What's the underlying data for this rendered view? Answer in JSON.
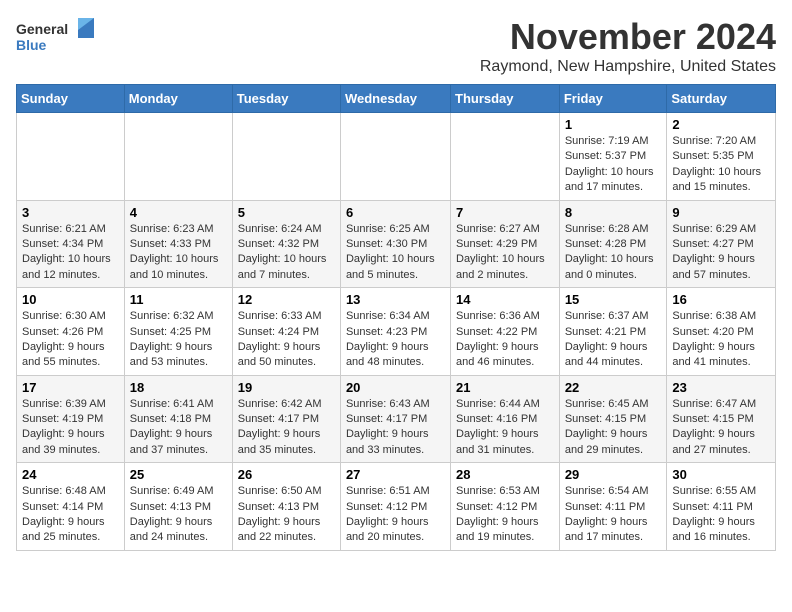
{
  "logo": {
    "general": "General",
    "blue": "Blue"
  },
  "title": "November 2024",
  "location": "Raymond, New Hampshire, United States",
  "weekdays": [
    "Sunday",
    "Monday",
    "Tuesday",
    "Wednesday",
    "Thursday",
    "Friday",
    "Saturday"
  ],
  "weeks": [
    [
      {
        "day": "",
        "info": ""
      },
      {
        "day": "",
        "info": ""
      },
      {
        "day": "",
        "info": ""
      },
      {
        "day": "",
        "info": ""
      },
      {
        "day": "",
        "info": ""
      },
      {
        "day": "1",
        "info": "Sunrise: 7:19 AM\nSunset: 5:37 PM\nDaylight: 10 hours and 17 minutes."
      },
      {
        "day": "2",
        "info": "Sunrise: 7:20 AM\nSunset: 5:35 PM\nDaylight: 10 hours and 15 minutes."
      }
    ],
    [
      {
        "day": "3",
        "info": "Sunrise: 6:21 AM\nSunset: 4:34 PM\nDaylight: 10 hours and 12 minutes."
      },
      {
        "day": "4",
        "info": "Sunrise: 6:23 AM\nSunset: 4:33 PM\nDaylight: 10 hours and 10 minutes."
      },
      {
        "day": "5",
        "info": "Sunrise: 6:24 AM\nSunset: 4:32 PM\nDaylight: 10 hours and 7 minutes."
      },
      {
        "day": "6",
        "info": "Sunrise: 6:25 AM\nSunset: 4:30 PM\nDaylight: 10 hours and 5 minutes."
      },
      {
        "day": "7",
        "info": "Sunrise: 6:27 AM\nSunset: 4:29 PM\nDaylight: 10 hours and 2 minutes."
      },
      {
        "day": "8",
        "info": "Sunrise: 6:28 AM\nSunset: 4:28 PM\nDaylight: 10 hours and 0 minutes."
      },
      {
        "day": "9",
        "info": "Sunrise: 6:29 AM\nSunset: 4:27 PM\nDaylight: 9 hours and 57 minutes."
      }
    ],
    [
      {
        "day": "10",
        "info": "Sunrise: 6:30 AM\nSunset: 4:26 PM\nDaylight: 9 hours and 55 minutes."
      },
      {
        "day": "11",
        "info": "Sunrise: 6:32 AM\nSunset: 4:25 PM\nDaylight: 9 hours and 53 minutes."
      },
      {
        "day": "12",
        "info": "Sunrise: 6:33 AM\nSunset: 4:24 PM\nDaylight: 9 hours and 50 minutes."
      },
      {
        "day": "13",
        "info": "Sunrise: 6:34 AM\nSunset: 4:23 PM\nDaylight: 9 hours and 48 minutes."
      },
      {
        "day": "14",
        "info": "Sunrise: 6:36 AM\nSunset: 4:22 PM\nDaylight: 9 hours and 46 minutes."
      },
      {
        "day": "15",
        "info": "Sunrise: 6:37 AM\nSunset: 4:21 PM\nDaylight: 9 hours and 44 minutes."
      },
      {
        "day": "16",
        "info": "Sunrise: 6:38 AM\nSunset: 4:20 PM\nDaylight: 9 hours and 41 minutes."
      }
    ],
    [
      {
        "day": "17",
        "info": "Sunrise: 6:39 AM\nSunset: 4:19 PM\nDaylight: 9 hours and 39 minutes."
      },
      {
        "day": "18",
        "info": "Sunrise: 6:41 AM\nSunset: 4:18 PM\nDaylight: 9 hours and 37 minutes."
      },
      {
        "day": "19",
        "info": "Sunrise: 6:42 AM\nSunset: 4:17 PM\nDaylight: 9 hours and 35 minutes."
      },
      {
        "day": "20",
        "info": "Sunrise: 6:43 AM\nSunset: 4:17 PM\nDaylight: 9 hours and 33 minutes."
      },
      {
        "day": "21",
        "info": "Sunrise: 6:44 AM\nSunset: 4:16 PM\nDaylight: 9 hours and 31 minutes."
      },
      {
        "day": "22",
        "info": "Sunrise: 6:45 AM\nSunset: 4:15 PM\nDaylight: 9 hours and 29 minutes."
      },
      {
        "day": "23",
        "info": "Sunrise: 6:47 AM\nSunset: 4:15 PM\nDaylight: 9 hours and 27 minutes."
      }
    ],
    [
      {
        "day": "24",
        "info": "Sunrise: 6:48 AM\nSunset: 4:14 PM\nDaylight: 9 hours and 25 minutes."
      },
      {
        "day": "25",
        "info": "Sunrise: 6:49 AM\nSunset: 4:13 PM\nDaylight: 9 hours and 24 minutes."
      },
      {
        "day": "26",
        "info": "Sunrise: 6:50 AM\nSunset: 4:13 PM\nDaylight: 9 hours and 22 minutes."
      },
      {
        "day": "27",
        "info": "Sunrise: 6:51 AM\nSunset: 4:12 PM\nDaylight: 9 hours and 20 minutes."
      },
      {
        "day": "28",
        "info": "Sunrise: 6:53 AM\nSunset: 4:12 PM\nDaylight: 9 hours and 19 minutes."
      },
      {
        "day": "29",
        "info": "Sunrise: 6:54 AM\nSunset: 4:11 PM\nDaylight: 9 hours and 17 minutes."
      },
      {
        "day": "30",
        "info": "Sunrise: 6:55 AM\nSunset: 4:11 PM\nDaylight: 9 hours and 16 minutes."
      }
    ]
  ]
}
